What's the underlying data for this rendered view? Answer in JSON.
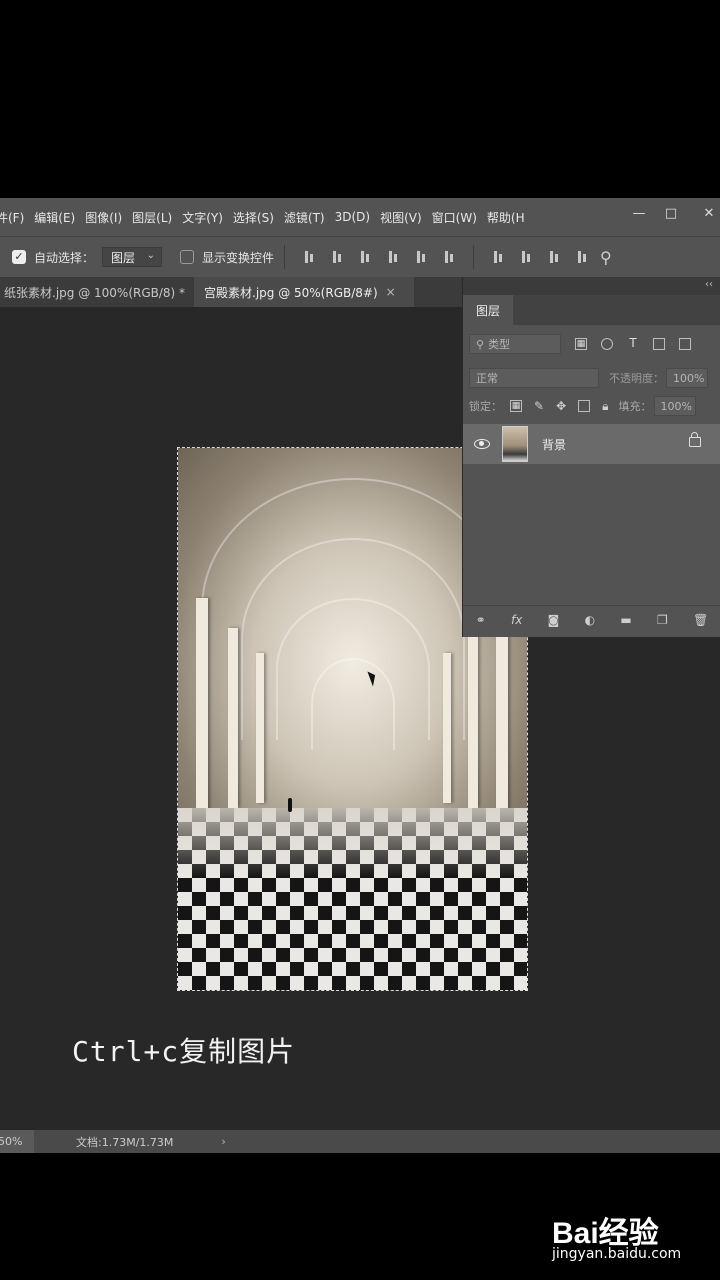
{
  "menu": [
    "件(F)",
    "编辑(E)",
    "图像(I)",
    "图层(L)",
    "文字(Y)",
    "选择(S)",
    "滤镜(T)",
    "3D(D)",
    "视图(V)",
    "窗口(W)",
    "帮助(H"
  ],
  "window_controls": {
    "minimize": "—",
    "maximize": "□",
    "close": "✕"
  },
  "options": {
    "auto_select_label": "自动选择：",
    "auto_select_checked": true,
    "auto_select_value": "图层",
    "show_transform_label": "显示变换控件",
    "show_transform_checked": false
  },
  "tabs": [
    {
      "label": "纸张素材.jpg @ 100%(RGB/8) *",
      "active": false
    },
    {
      "label": "宫殿素材.jpg @ 50%(RGB/8#)",
      "active": true
    }
  ],
  "layers": {
    "title": "图层",
    "filter_placeholder": "类型",
    "blend_mode": "正常",
    "opacity_label": "不透明度：",
    "opacity_value": "100%",
    "lock_label": "锁定：",
    "fill_label": "填充：",
    "fill_value": "100%",
    "items": [
      {
        "name": "背景",
        "visible": true,
        "locked": true
      }
    ]
  },
  "status": {
    "zoom": "50%",
    "doc_info": "文档:1.73M/1.73M"
  },
  "caption": "Ctrl+c复制图片",
  "watermark": {
    "logo": "Bai经验",
    "url": "jingyan.baidu.com"
  }
}
